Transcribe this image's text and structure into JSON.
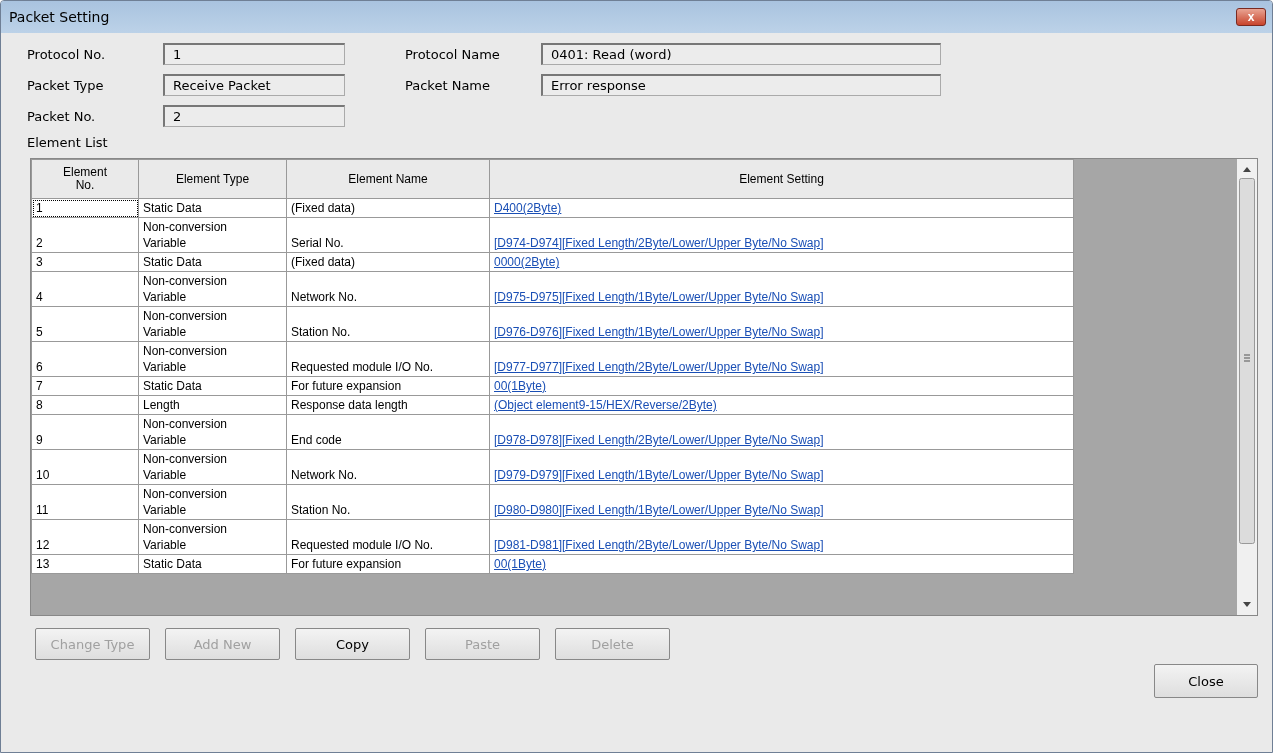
{
  "window": {
    "title": "Packet Setting",
    "close": "x"
  },
  "fields": [
    {
      "label": "Protocol No.",
      "value": "1"
    },
    {
      "label": "Protocol Name",
      "value": "0401: Read (word)"
    },
    {
      "label": "Packet Type",
      "value": "Receive Packet"
    },
    {
      "label": "Packet Name",
      "value": "Error response"
    },
    {
      "label": "Packet No.",
      "value": "2"
    }
  ],
  "element_list": {
    "title": "Element List",
    "columns": [
      "Element No.",
      "Element Type",
      "Element Name",
      "Element Setting"
    ],
    "rows": [
      {
        "no": "1",
        "type": [
          "Static Data"
        ],
        "name": "(Fixed data)",
        "setting": "D400(2Byte)",
        "focused": true
      },
      {
        "no": "2",
        "type": [
          "Non-conversion",
          "Variable"
        ],
        "name": "Serial No.",
        "setting": "[D974-D974][Fixed Length/2Byte/Lower/Upper Byte/No Swap]",
        "focused": false
      },
      {
        "no": "3",
        "type": [
          "Static Data"
        ],
        "name": "(Fixed data)",
        "setting": "0000(2Byte)",
        "focused": false
      },
      {
        "no": "4",
        "type": [
          "Non-conversion",
          "Variable"
        ],
        "name": "Network No.",
        "setting": "[D975-D975][Fixed Length/1Byte/Lower/Upper Byte/No Swap]",
        "focused": false
      },
      {
        "no": "5",
        "type": [
          "Non-conversion",
          "Variable"
        ],
        "name": "Station No.",
        "setting": "[D976-D976][Fixed Length/1Byte/Lower/Upper Byte/No Swap]",
        "focused": false
      },
      {
        "no": "6",
        "type": [
          "Non-conversion",
          "Variable"
        ],
        "name": "Requested module I/O No.",
        "setting": "[D977-D977][Fixed Length/2Byte/Lower/Upper Byte/No Swap]",
        "focused": false
      },
      {
        "no": "7",
        "type": [
          "Static Data"
        ],
        "name": "For future expansion",
        "setting": "00(1Byte)",
        "focused": false
      },
      {
        "no": "8",
        "type": [
          "Length"
        ],
        "name": "Response data length",
        "setting": "(Object element9-15/HEX/Reverse/2Byte)",
        "focused": false
      },
      {
        "no": "9",
        "type": [
          "Non-conversion",
          "Variable"
        ],
        "name": "End code",
        "setting": "[D978-D978][Fixed Length/2Byte/Lower/Upper Byte/No Swap]",
        "focused": false
      },
      {
        "no": "10",
        "type": [
          "Non-conversion",
          "Variable"
        ],
        "name": "Network No.",
        "setting": "[D979-D979][Fixed Length/1Byte/Lower/Upper Byte/No Swap]",
        "focused": false
      },
      {
        "no": "11",
        "type": [
          "Non-conversion",
          "Variable"
        ],
        "name": "Station No.",
        "setting": "[D980-D980][Fixed Length/1Byte/Lower/Upper Byte/No Swap]",
        "focused": false
      },
      {
        "no": "12",
        "type": [
          "Non-conversion",
          "Variable"
        ],
        "name": "Requested module I/O No.",
        "setting": "[D981-D981][Fixed Length/2Byte/Lower/Upper Byte/No Swap]",
        "focused": false
      },
      {
        "no": "13",
        "type": [
          "Static Data"
        ],
        "name": "For future expansion",
        "setting": "00(1Byte)",
        "focused": false
      }
    ]
  },
  "buttons": [
    {
      "label": "Change Type",
      "disabled": true
    },
    {
      "label": "Add New",
      "disabled": true
    },
    {
      "label": "Copy",
      "disabled": false
    },
    {
      "label": "Paste",
      "disabled": true
    },
    {
      "label": "Delete",
      "disabled": true
    }
  ],
  "close_button": {
    "label": "Close",
    "disabled": false
  }
}
